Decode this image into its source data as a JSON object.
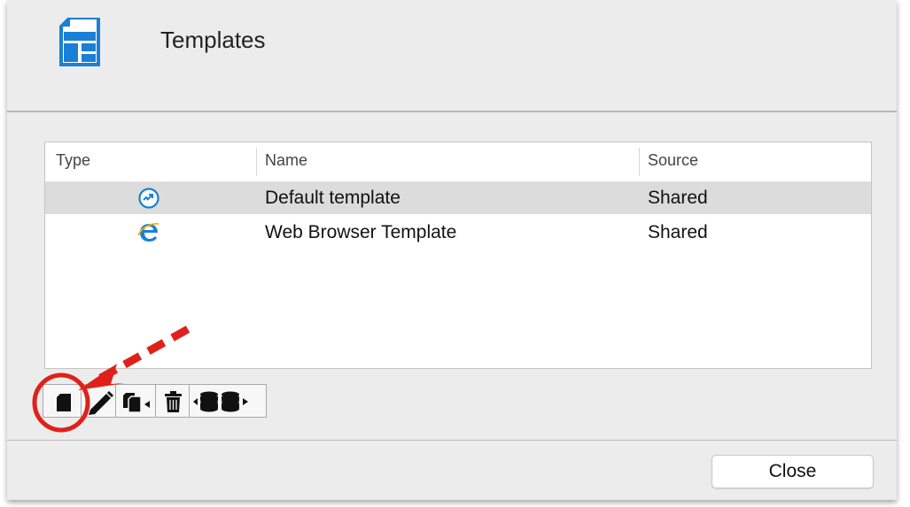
{
  "header": {
    "title": "Templates",
    "icon": "templates-icon"
  },
  "table": {
    "columns": [
      "Type",
      "Name",
      "Source"
    ],
    "rows": [
      {
        "type_icon": "remote-desktop-icon",
        "name": "Default template",
        "source": "Shared",
        "selected": true
      },
      {
        "type_icon": "web-browser-icon",
        "name": "Web Browser Template",
        "source": "Shared",
        "selected": false
      }
    ]
  },
  "toolbar": {
    "buttons": [
      "add-template-icon",
      "edit-template-icon",
      "duplicate-template-icon",
      "delete-template-icon",
      "import-export-icon"
    ]
  },
  "footer": {
    "close_label": "Close"
  },
  "colors": {
    "accent_blue": "#1a7fd6",
    "annotation_red": "#e0201a"
  }
}
